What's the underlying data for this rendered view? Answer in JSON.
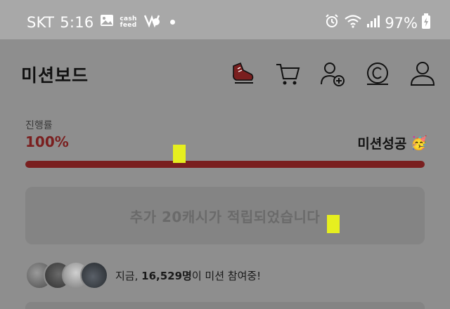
{
  "status_bar": {
    "carrier": "SKT",
    "time": "5:16",
    "notif_cash": "cash feed",
    "battery": "97%"
  },
  "header": {
    "title": "미션보드",
    "icons": [
      "shoe-icon",
      "cart-icon",
      "add-friend-icon",
      "coin-icon",
      "profile-icon"
    ]
  },
  "progress": {
    "label": "진행률",
    "percent_text": "100%",
    "value": 1.0,
    "status": "미션성공",
    "status_emoji": "🥳"
  },
  "reward": {
    "message": "추가 20캐시가 적립되었습니다"
  },
  "participants": {
    "prefix": "지금, ",
    "count": "16,529명",
    "suffix": "이 미션 참여중!"
  },
  "colors": {
    "accent": "#7a1f1f",
    "marker": "#e6ef1f",
    "dim_overlay": "#8e8e8e"
  }
}
